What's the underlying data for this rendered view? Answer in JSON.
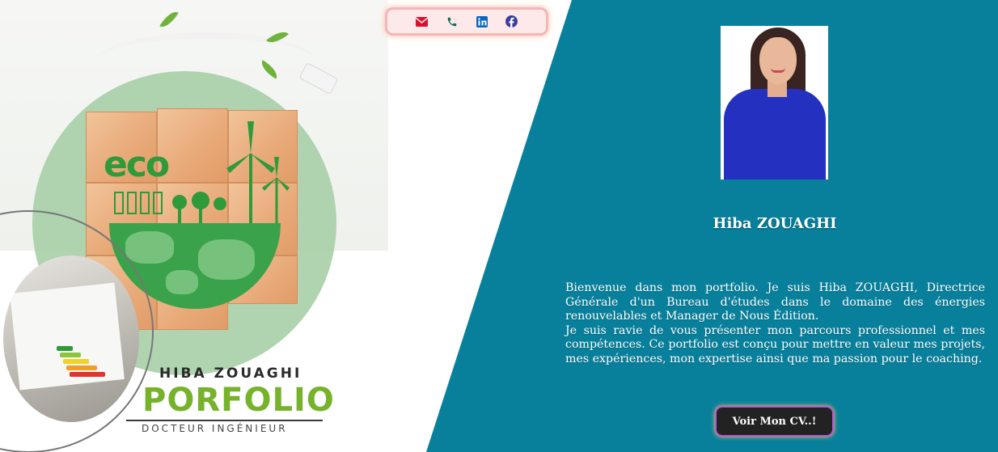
{
  "contact": {
    "icons": [
      "envelope-icon",
      "phone-icon",
      "linkedin-icon",
      "facebook-icon"
    ],
    "colors": {
      "envelope": "#d8112c",
      "phone": "#0f6a55",
      "linkedin": "#0a66c2",
      "facebook": "#3b3f9c"
    }
  },
  "brand": {
    "name": "HIBA ZOUAGHI",
    "title": "PORFOLIO",
    "subtitle": "DOCTEUR INGÉNIEUR",
    "logo_text": "eco"
  },
  "profile": {
    "name": "Hiba ZOUAGHI",
    "bio": [
      "Bienvenue dans mon portfolio. Je suis Hiba ZOUAGHI, Directrice Générale d'un Bureau d'études dans le domaine des énergies renouvelables et Manager de Nous Édition.",
      "Je suis ravie de vous présenter mon parcours professionnel et mes compétences. Ce portfolio est conçu pour mettre en valeur mes projets, mes expériences, mon expertise ainsi que ma passion pour le coaching."
    ]
  },
  "cv_button": {
    "label": "Voir Mon CV..!"
  },
  "theme": {
    "panel": "#08809c",
    "accent_green": "#76b32a",
    "button_bg": "#222222"
  }
}
